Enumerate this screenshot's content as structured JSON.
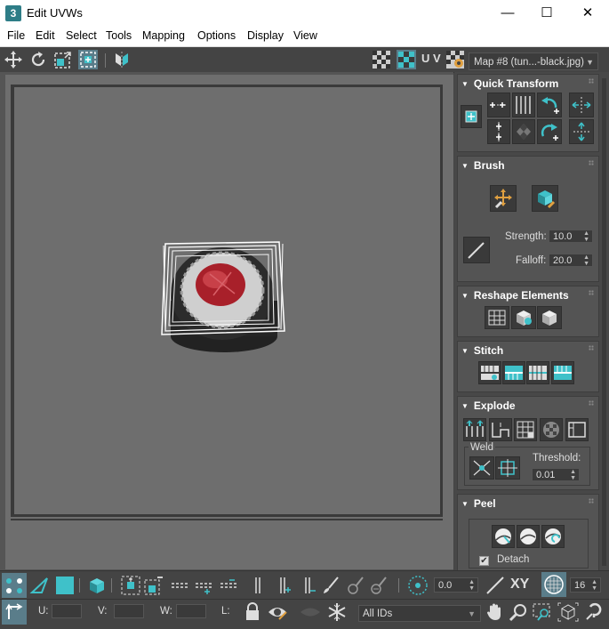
{
  "window": {
    "title": "Edit UVWs",
    "app_icon_label": "3",
    "controls": {
      "minimize": "—",
      "maximize": "☐",
      "close": "✕"
    }
  },
  "menu": [
    "File",
    "Edit",
    "Select",
    "Tools",
    "Mapping",
    "Options",
    "Display",
    "View"
  ],
  "toolbar": {
    "uv_label": "U V",
    "map_select": "Map #8 (tun...-black.jpg)"
  },
  "panel": {
    "quick_transform": {
      "title": "Quick Transform"
    },
    "brush": {
      "title": "Brush",
      "strength_label": "Strength:",
      "strength_value": "10.0",
      "falloff_label": "Falloff:",
      "falloff_value": "20.0"
    },
    "reshape": {
      "title": "Reshape Elements"
    },
    "stitch": {
      "title": "Stitch"
    },
    "explode": {
      "title": "Explode",
      "weld_label": "Weld",
      "threshold_label": "Threshold:",
      "threshold_value": "0.01"
    },
    "peel": {
      "title": "Peel",
      "detach_label": "Detach",
      "detach_checked": true
    }
  },
  "bottom": {
    "rotation_value": "0.0",
    "xy_label": "XY",
    "grid_value": "16",
    "u_label": "U:",
    "v_label": "V:",
    "w_label": "W:",
    "l_label": "L:",
    "ids_select": "All IDs"
  },
  "colors": {
    "accent": "#3fc1c9",
    "panel_bg": "#545454",
    "viewport_bg": "#6e6e6e"
  }
}
